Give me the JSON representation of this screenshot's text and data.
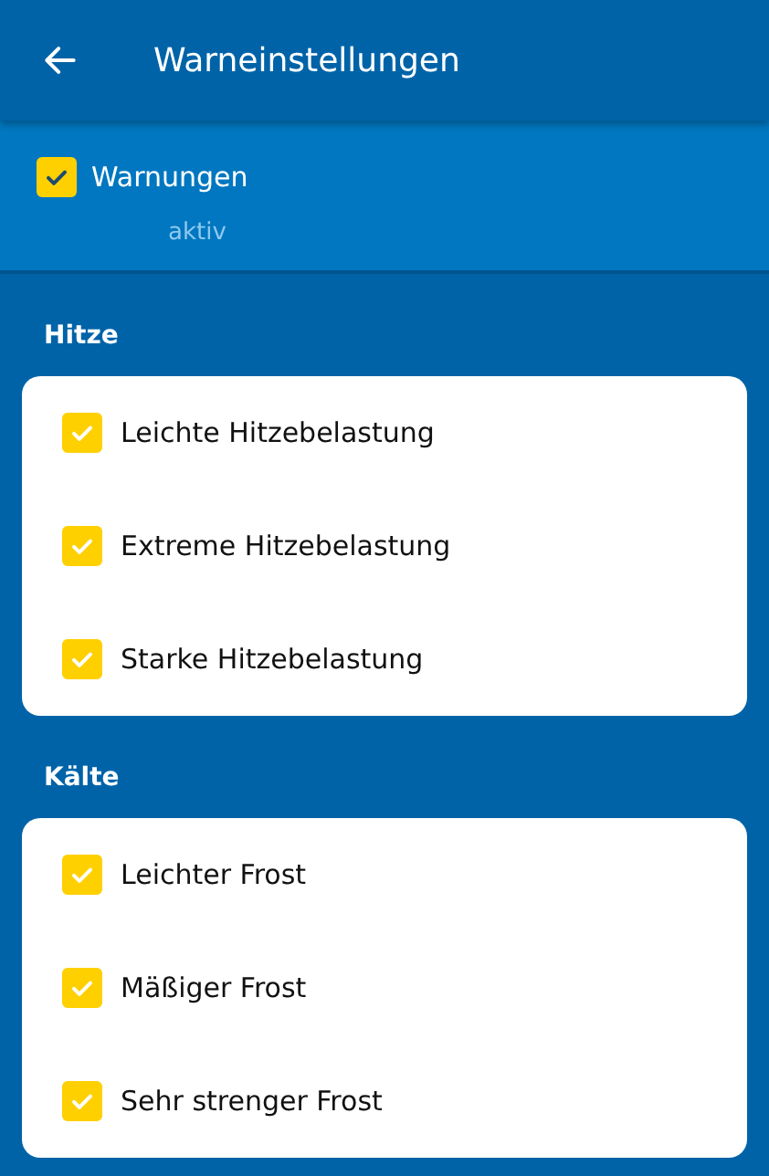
{
  "app_bar": {
    "title": "Warneinstellungen"
  },
  "master": {
    "label": "Warnungen",
    "summary": "aktiv",
    "checked": true
  },
  "sections": [
    {
      "title": "Hitze",
      "items": [
        {
          "label": "Leichte Hitzebelastung",
          "checked": true
        },
        {
          "label": "Extreme Hitzebelastung",
          "checked": true
        },
        {
          "label": "Starke Hitzebelastung",
          "checked": true
        }
      ]
    },
    {
      "title": "Kälte",
      "items": [
        {
          "label": "Leichter Frost",
          "checked": true
        },
        {
          "label": "Mäßiger Frost",
          "checked": true
        },
        {
          "label": "Sehr strenger Frost",
          "checked": true
        }
      ]
    }
  ]
}
